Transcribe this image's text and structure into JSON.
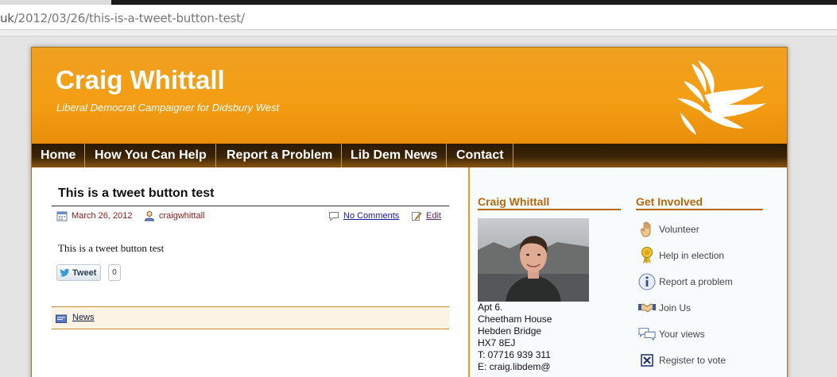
{
  "browser": {
    "url_host_tail": "uk",
    "url_path": "/2012/03/26/this-is-a-tweet-button-test/"
  },
  "site": {
    "title": "Craig Whittall",
    "tagline": "Liberal Democrat Campaigner for Didsbury West"
  },
  "nav": {
    "items": [
      {
        "label": "Home"
      },
      {
        "label": "How You Can Help"
      },
      {
        "label": "Report a Problem"
      },
      {
        "label": "Lib Dem News"
      },
      {
        "label": "Contact"
      }
    ]
  },
  "post": {
    "title": "This is a tweet button test",
    "date": "March 26, 2012",
    "author": "craigwhittall",
    "comments_label": "No Comments",
    "edit_label": "Edit",
    "body": "This is a tweet button test",
    "tweet_label": "Tweet",
    "tweet_count": "0",
    "category": "News"
  },
  "sidebar": {
    "profile_title": "Craig Whittall",
    "address_lines": [
      "Apt 6.",
      "Cheetham House",
      "Hebden Bridge",
      "HX7 8EJ",
      "T: 07716 939 311",
      "E: craig.libdem@"
    ],
    "get_involved_title": "Get Involved",
    "get_involved": [
      {
        "label": "Volunteer",
        "icon": "hand-icon"
      },
      {
        "label": "Help in election",
        "icon": "rosette-icon"
      },
      {
        "label": "Report a problem",
        "icon": "info-icon"
      },
      {
        "label": "Join Us",
        "icon": "handshake-icon"
      },
      {
        "label": "Your views",
        "icon": "speech-bubbles-icon"
      },
      {
        "label": "Register to vote",
        "icon": "ballot-checkbox-icon"
      }
    ]
  },
  "colors": {
    "header_orange": "#f39e14",
    "nav_dark": "#2c1a05",
    "accent_brown": "#b5680c"
  }
}
